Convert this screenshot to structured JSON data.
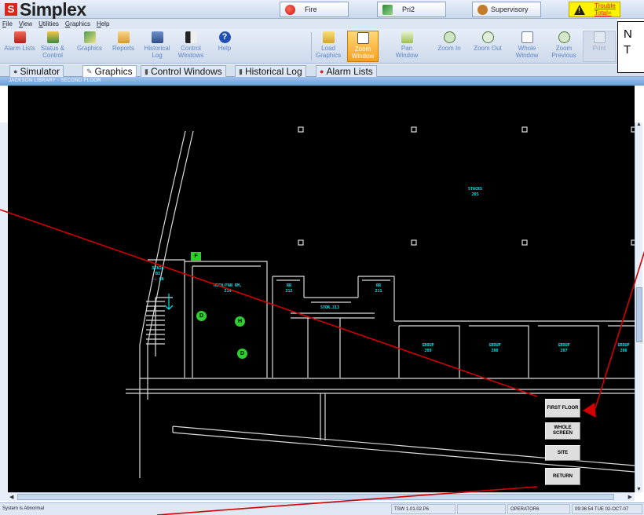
{
  "banner": {
    "logo_text": "Simplex",
    "logo_mark": "S",
    "fire_label": "Fire",
    "pri2_label": "Pri2",
    "supervisory_label": "Supervisory",
    "trouble_label": "Trouble",
    "total_label": "Total="
  },
  "callout": {
    "line1": "N",
    "line2": "T"
  },
  "menu": [
    "File",
    "View",
    "Utilities",
    "Graphics",
    "Help"
  ],
  "toolbar": {
    "alarm_lists": "Alarm Lists",
    "status_control": "Status & Control",
    "graphics": "Graphics",
    "reports": "Reports",
    "historical_log": "Historical Log",
    "control_windows": "Control Windows",
    "help": "Help",
    "load_graphics": "Load Graphics",
    "zoom_window": "Zoom Window",
    "pan_window": "Pan Window",
    "zoom_in": "Zoom In",
    "zoom_out": "Zoom Out",
    "whole_window": "Whole Window",
    "zoom_previous": "Zoom Previous",
    "print": "Print"
  },
  "tabs": [
    "Simulator",
    "Graphics",
    "Control Windows",
    "Historical Log",
    "Alarm Lists"
  ],
  "tab_close": "×",
  "view_title": "JACKSON LIBRARY - SECOND FLOOR",
  "rooms": {
    "stacks": "STACKS\n203",
    "stair": "STAIR\nB3\n-- 6N",
    "mech": "MECH/FAN RM.\n214",
    "rr1": "RR\n212",
    "rr2": "RR\n211",
    "stor": "STOR.213",
    "group1": "GROUP\n209",
    "group2": "GROUP\n208",
    "group3": "GROUP\n207",
    "group4": "GROUP\n206"
  },
  "devices": {
    "fire": "F",
    "d1": "D",
    "h": "H",
    "d2": "D"
  },
  "nav_buttons": {
    "first_floor": "FIRST FLOOR",
    "whole_screen": "WHOLE SCREEN",
    "site": "SITE",
    "return": "RETURN"
  },
  "status": {
    "message": "System is Abnormal",
    "version": "TSW 1.01.02.P6",
    "operator": "OPERATOR6",
    "datetime": "09:36:54 TUE 02-OCT-07"
  },
  "colors": {
    "fire": "#d9261c",
    "trouble": "#fff200",
    "active_tool": "#f6a21c",
    "room_label": "#00e5ee",
    "device": "#2fcf2f",
    "annotation": "#d40000"
  }
}
